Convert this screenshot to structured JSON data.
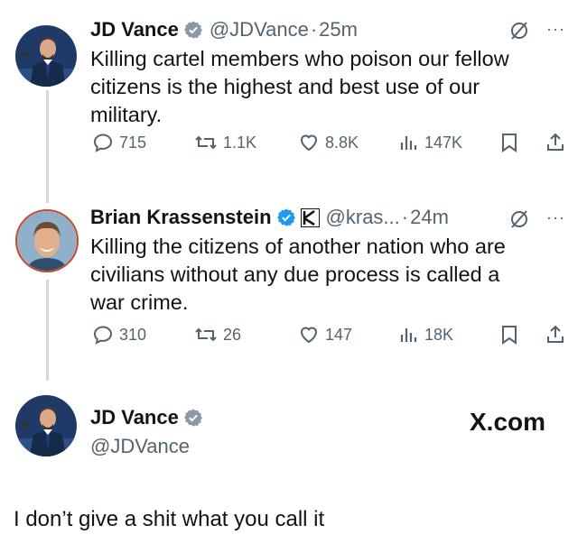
{
  "tweets": [
    {
      "name": "JD Vance",
      "handle": "@JDVance",
      "separator": "·",
      "time": "25m",
      "text_lines": [
        "Killing cartel members who poison our fellow",
        "citizens is the highest and best use of our",
        "military."
      ],
      "replies": "715",
      "reposts": "1.1K",
      "likes": "8.8K",
      "views": "147K"
    },
    {
      "name": "Brian Krassenstein",
      "handle": "@kras...",
      "separator": "·",
      "time": "24m",
      "text_lines": [
        "Killing the citizens of another nation who are",
        "civilians without any due process is called a",
        "war crime."
      ],
      "replies": "310",
      "reposts": "26",
      "likes": "147",
      "views": "18K"
    }
  ],
  "card": {
    "name": "JD Vance",
    "handle": "@JDVance",
    "site": "X.com"
  },
  "reply_text": "I don’t give a shit what you call it",
  "colors": {
    "verified": "#1d9bf0",
    "muted": "#536471",
    "thread_line": "#cfd9de",
    "text": "#0f1419"
  },
  "icons": [
    "verified-badge-icon",
    "grok-icon",
    "more-icon",
    "reply-icon",
    "repost-icon",
    "like-icon",
    "views-icon",
    "bookmark-icon",
    "share-icon",
    "affiliate-badge-icon"
  ]
}
